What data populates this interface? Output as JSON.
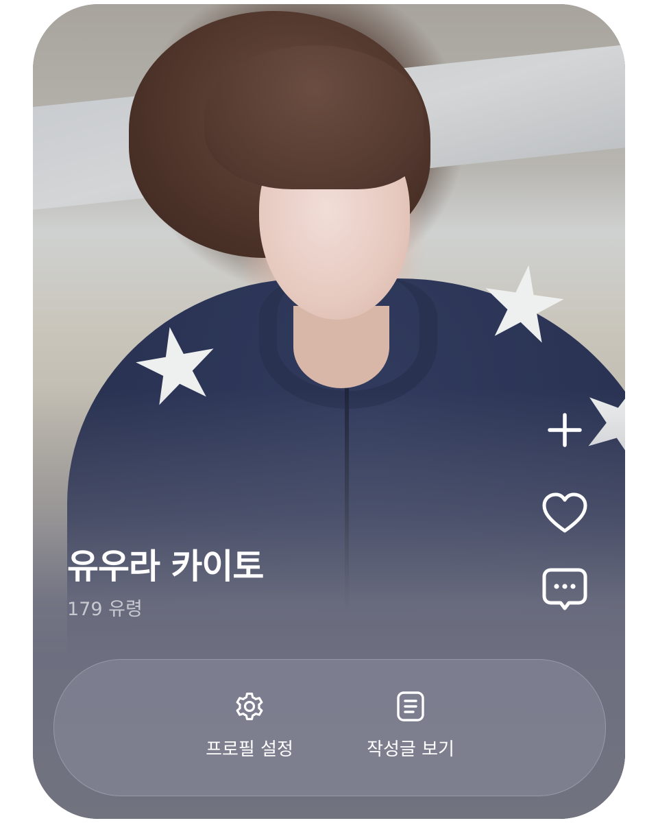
{
  "profile": {
    "name": "유우라 카이토",
    "subtitle": "179 유령"
  },
  "side_actions": {
    "icons": [
      "plus-icon",
      "heart-icon",
      "chat-bubble-icon"
    ]
  },
  "bottom_panel": {
    "settings_label": "프로필 설정",
    "settings_icon": "gear-icon",
    "posts_label": "작성글 보기",
    "posts_icon": "document-icon"
  },
  "colors": {
    "text_primary": "#ffffff",
    "text_secondary": "#c8c9d1",
    "panel_bg": "#6f7183"
  }
}
